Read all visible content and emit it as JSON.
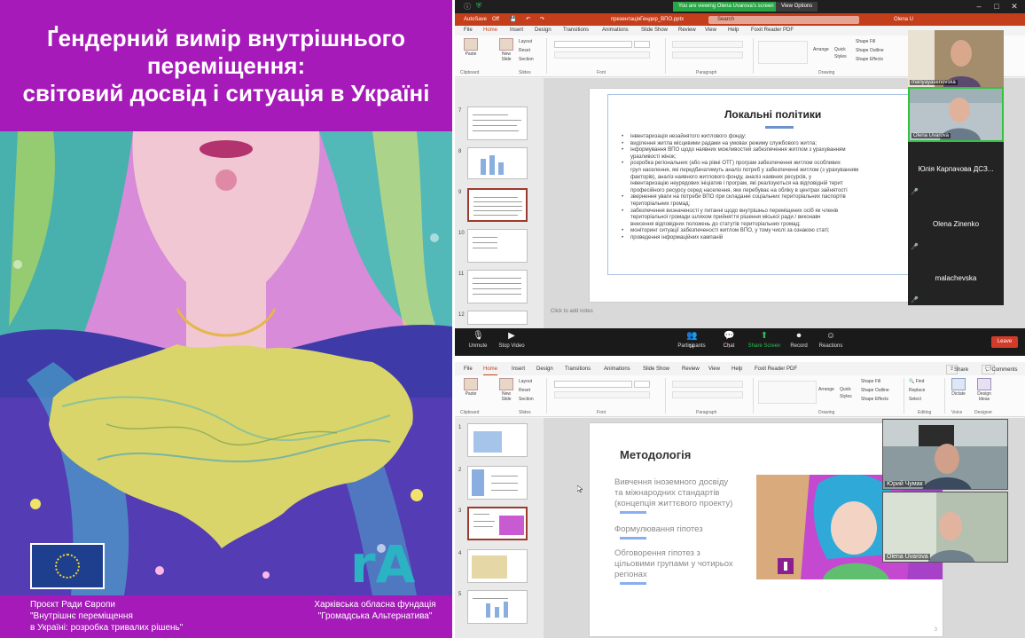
{
  "poster": {
    "title": "Ґендерний вимір внутрішнього\nпереміщення:\nсвітовий досвід і ситуація в Україні",
    "footer_left": "Проєкт Ради Європи\n\"Внутрішнє переміщення\nв Україні: розробка тривалих рішень\"",
    "footer_right": "Харківська обласна фундація\n\"Громадська Альтернатива\"",
    "ra_logo": "rA"
  },
  "zoom_top": {
    "banner": "You are viewing Olena Uvarova's screen",
    "view_options": "View Options",
    "controls": [
      {
        "label": "Unmute",
        "icon": "microphone-muted-icon"
      },
      {
        "label": "Stop Video",
        "icon": "video-camera-icon"
      },
      {
        "label": "Participants",
        "icon": "participants-icon",
        "count": "14"
      },
      {
        "label": "Chat",
        "icon": "chat-icon"
      },
      {
        "label": "Share Screen",
        "icon": "share-screen-icon"
      },
      {
        "label": "Record",
        "icon": "record-icon"
      },
      {
        "label": "Reactions",
        "icon": "reactions-icon"
      }
    ],
    "chat_badge": "1",
    "leave": "Leave",
    "participants": [
      {
        "name": "mariyayasenovska"
      },
      {
        "name": "Olena Uvarova"
      },
      {
        "name": "Юлія Карпачова ДСЗ..."
      },
      {
        "name": "Olena Zinenko"
      },
      {
        "name": "malachevska"
      }
    ]
  },
  "ppt_top": {
    "autosave": "AutoSave",
    "autosave_state": "Off",
    "filename": "презентаціяГендер_ВПО.pptx",
    "search": "Search",
    "user": "Olena U",
    "menu": [
      "File",
      "Home",
      "Insert",
      "Design",
      "Transitions",
      "Animations",
      "Slide Show",
      "Review",
      "View",
      "Help",
      "Foxit Reader PDF"
    ],
    "ribbon": {
      "paste": "Paste",
      "new_slide": "New Slide",
      "layout": "Layout",
      "reset": "Reset",
      "section": "Section",
      "arrange": "Arrange",
      "quick_styles": "Quick Styles",
      "shape_fill": "Shape Fill",
      "shape_outline": "Shape Outline",
      "shape_effects": "Shape Effects",
      "groups": [
        "Clipboard",
        "Slides",
        "Font",
        "Paragraph",
        "Drawing"
      ]
    },
    "thumb_numbers": [
      "7",
      "8",
      "9",
      "10",
      "11",
      "12"
    ],
    "notes_placeholder": "Click to add notes",
    "slide": {
      "title": "Локальні політики",
      "bullets": [
        "інвентаризація незайнятого житлового фонду;",
        "виділення житла місцевими радами на умовах режиму службового житла;",
        "інформування ВПО щодо наявних можливостей забезпечення житлом з урахуванням\nуразливості жінок;",
        "розробка регіональних (або на рівні ОТГ) програм забезпечення житлом особливих\nгруп населення, які передбачатимуть аналіз потреб у забезпеченні житлом (з урахуванням\nфакторів), аналіз наявного житлового фонду, аналіз наявних ресурсів, у\nінвентаризацію неурядових ініціатив і програм, які реалізуються на відповідній терит\nпрофесійного ресурсу серед населення, яке перебуває на обліку в центрах зайнятості",
        "звернення уваги на потреби ВПО при складанні соціальних територіальних паспортів\nтериторіальних громад;",
        "забезпечення визначеності у питанні щодо внутрішньо переміщених осіб як членів\nтериторіальної громади шляхом прийняття рішення міської ради / виконавч\nвнесення відповідних положень до статутів територіальних громад;",
        "моніторинг ситуації забезпеченості житлом ВПО, у тому числі за ознакою статі;",
        "проведення інформаційних кампаній"
      ]
    }
  },
  "ppt_bottom": {
    "menu": [
      "File",
      "Home",
      "Insert",
      "Design",
      "Transitions",
      "Animations",
      "Slide Show",
      "Review",
      "View",
      "Help",
      "Foxit Reader PDF"
    ],
    "share": "Share",
    "comments": "Comments",
    "ribbon": {
      "paste": "Paste",
      "new_slide": "New Slide",
      "layout": "Layout",
      "reset": "Reset",
      "section": "Section",
      "arrange": "Arrange",
      "quick_styles": "Quick Styles",
      "shape_fill": "Shape Fill",
      "shape_outline": "Shape Outline",
      "shape_effects": "Shape Effects",
      "find": "Find",
      "replace": "Replace",
      "select": "Select",
      "dictate": "Dictate",
      "design_ideas": "Design Ideas",
      "groups": [
        "Clipboard",
        "Slides",
        "Font",
        "Paragraph",
        "Drawing",
        "Editing",
        "Voice",
        "Designer"
      ]
    },
    "thumb_numbers": [
      "1",
      "2",
      "3",
      "4",
      "5"
    ],
    "slide_number": "3",
    "slide": {
      "title": "Методологія",
      "items": [
        "Вивчення іноземного досвіду\nта міжнародних стандартів\n(концепція життєвого проекту)",
        "Формулювання гіпотез",
        "Обговорення гіпотез з\nцільовими групами у чотирьох\nрегіонах"
      ]
    },
    "videos": [
      {
        "name": "Юрий Чумак"
      },
      {
        "name": "Olena Uvarova"
      }
    ]
  },
  "colors": {
    "poster_purple": "#a51ab8",
    "ppt_accent": "#c43e1c",
    "zoom_green": "#27a844",
    "leave_red": "#d13c2a"
  }
}
